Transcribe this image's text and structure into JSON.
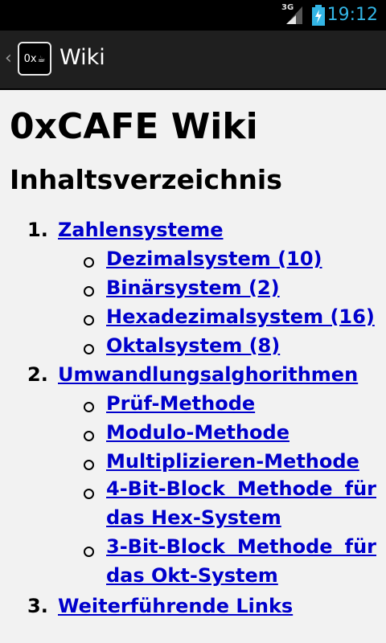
{
  "status_bar": {
    "network": "3G",
    "time": "19:12"
  },
  "action_bar": {
    "icon_text": "0x",
    "title": "Wiki"
  },
  "page": {
    "title": "0xCAFE Wiki",
    "toc_heading": "Inhaltsverzeichnis"
  },
  "toc": {
    "item1": {
      "number": "1.",
      "label": "Zahlensysteme",
      "sub": [
        "Dezimalsystem (10)",
        "Binärsystem (2)",
        "Hexadezimalsystem (16)",
        "Oktalsystem (8)"
      ]
    },
    "item2": {
      "number": "2.",
      "label": "Umwandlungsalghorithmen",
      "sub": [
        "Prüf-Methode",
        "Modulo-Methode",
        "Multiplizieren-Methode"
      ],
      "sub_wrap": [
        {
          "line1": "4-Bit-Block Methode für",
          "line2": "das Hex-System"
        },
        {
          "line1": "3-Bit-Block Methode für",
          "line2": "das Okt-System"
        }
      ]
    },
    "item3": {
      "number": "3.",
      "label": "Weiterführende Links"
    }
  },
  "colors": {
    "link": "#0000cc",
    "accent": "#33b5e5",
    "action_bar": "#1f1f1f"
  }
}
